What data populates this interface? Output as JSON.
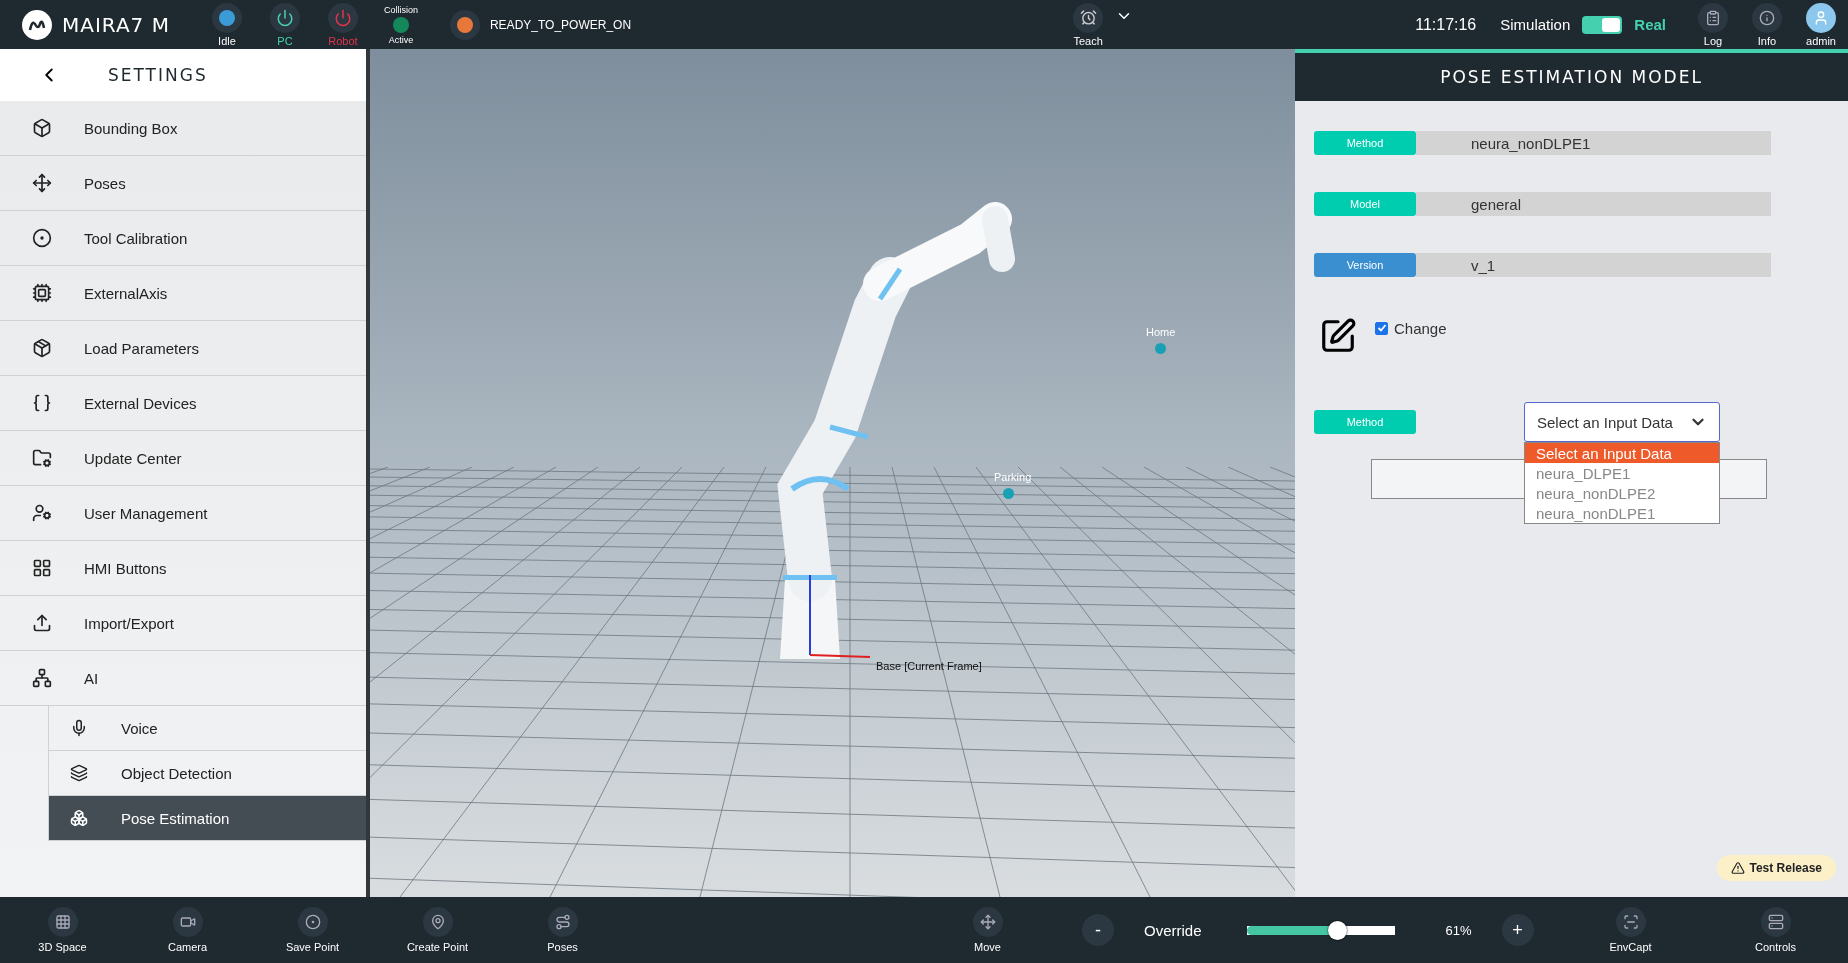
{
  "topbar": {
    "brand": "MAIRA7 M",
    "statuses": [
      {
        "kind": "dot",
        "label": "Idle",
        "color": "#3b9bd6"
      },
      {
        "kind": "power",
        "label": "PC",
        "color": "#45d1b0"
      },
      {
        "kind": "power",
        "label": "Robot",
        "color": "#e0344a"
      },
      {
        "kind": "collision",
        "caption": "Collision",
        "label": "Active",
        "color": "#14885a"
      }
    ],
    "state": {
      "label": "READY_TO_POWER_ON",
      "color": "#e8773a"
    },
    "mode": {
      "label": "Teach"
    },
    "time": "11:17:16",
    "toggle": {
      "left": "Simulation",
      "right": "Real",
      "on": true
    },
    "actions": [
      {
        "label": "Log"
      },
      {
        "label": "Info"
      },
      {
        "label": "admin"
      }
    ]
  },
  "sidebar": {
    "title": "SETTINGS",
    "items": [
      {
        "label": "Bounding Box",
        "selected": false
      },
      {
        "label": "Poses",
        "selected": false
      },
      {
        "label": "Tool Calibration",
        "selected": false
      },
      {
        "label": "ExternalAxis",
        "selected": false
      },
      {
        "label": "Load Parameters",
        "selected": false
      },
      {
        "label": "External Devices",
        "selected": false
      },
      {
        "label": "Update Center",
        "selected": false
      },
      {
        "label": "User Management",
        "selected": false
      },
      {
        "label": "HMI Buttons",
        "selected": false
      },
      {
        "label": "Import/Export",
        "selected": false
      },
      {
        "label": "AI",
        "selected": false,
        "children": [
          {
            "label": "Voice",
            "selected": false
          },
          {
            "label": "Object Detection",
            "selected": false
          },
          {
            "label": "Pose Estimation",
            "selected": true
          }
        ]
      }
    ]
  },
  "viewport": {
    "markers": [
      {
        "label": "Home"
      },
      {
        "label": "Parking"
      }
    ],
    "frame_label": "Base [Current Frame]"
  },
  "panel": {
    "title": "POSE ESTIMATION MODEL",
    "fields": [
      {
        "label": "Method",
        "value": "neura_nonDLPE1",
        "color": "#00cdb0"
      },
      {
        "label": "Model",
        "value": "general",
        "color": "#00cdb0"
      },
      {
        "label": "Version",
        "value": "v_1",
        "color": "#3a8fd0"
      }
    ],
    "change": {
      "label": "Change",
      "checked": true
    },
    "select": {
      "label": "Method",
      "color": "#00cdb0",
      "value": "Select an Input Data",
      "expanded": true,
      "options": [
        {
          "label": "Select an Input Data",
          "selected": true
        },
        {
          "label": "neura_DLPE1",
          "selected": false
        },
        {
          "label": "neura_nonDLPE2",
          "selected": false
        },
        {
          "label": "neura_nonDLPE1",
          "selected": false
        }
      ]
    },
    "badge": "Test Release"
  },
  "bottombar": {
    "left": [
      {
        "label": "3D Space"
      },
      {
        "label": "Camera"
      },
      {
        "label": "Save Point"
      },
      {
        "label": "Create Point"
      },
      {
        "label": "Poses"
      }
    ],
    "move": {
      "label": "Move"
    },
    "override": {
      "minus": "-",
      "label": "Override",
      "level": 0.61,
      "reading": "61%",
      "plus": "+"
    },
    "right": [
      {
        "label": "EnvCapt"
      },
      {
        "label": "Controls"
      }
    ]
  }
}
